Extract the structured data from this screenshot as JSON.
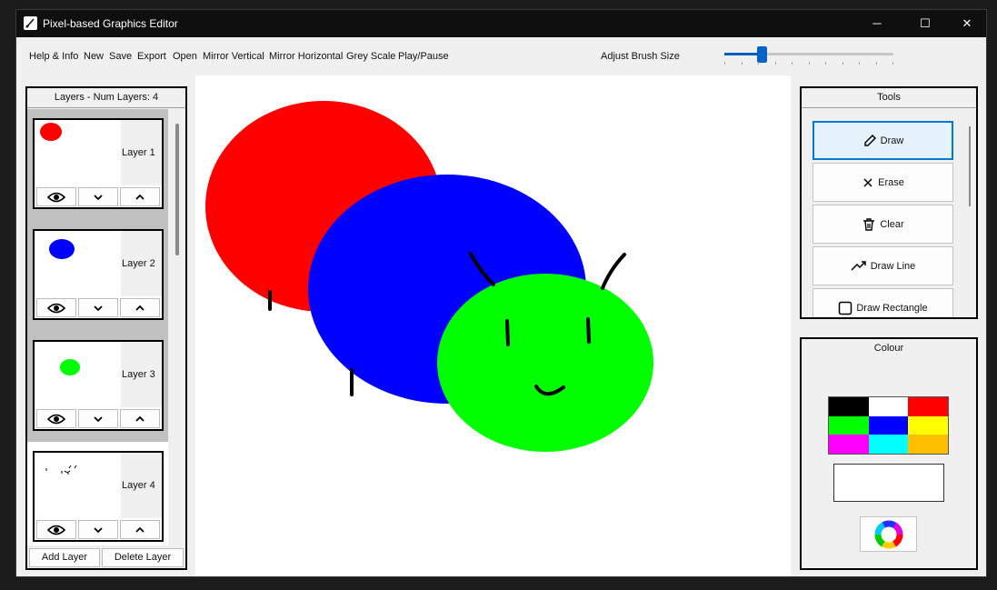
{
  "window": {
    "title": "Pixel-based Graphics Editor",
    "minimize_glyph": "─",
    "maximize_glyph": "☐",
    "close_glyph": "✕"
  },
  "menu": {
    "items": [
      "Help & Info",
      "New",
      "Save",
      "Export",
      "Open",
      "Mirror Vertical",
      "Mirror Horizontal",
      "Grey Scale",
      "Play/Pause"
    ],
    "brush_label": "Adjust Brush Size",
    "brush_size_fraction": 0.22
  },
  "layers": {
    "header": "Layers -  Num Layers: 4",
    "items": [
      {
        "label": "Layer 1",
        "selected": true
      },
      {
        "label": "Layer 2",
        "selected": true
      },
      {
        "label": "Layer 3",
        "selected": true
      },
      {
        "label": "Layer 4",
        "selected": false
      }
    ],
    "add_label": "Add Layer",
    "delete_label": "Delete Layer"
  },
  "tools": {
    "header": "Tools",
    "items": [
      {
        "label": "Draw",
        "icon": "pencil-icon",
        "active": true
      },
      {
        "label": "Erase",
        "icon": "x-icon",
        "active": false
      },
      {
        "label": "Clear",
        "icon": "trash-icon",
        "active": false
      },
      {
        "label": "Draw Line",
        "icon": "trend-line-icon",
        "active": false
      },
      {
        "label": "Draw Rectangle",
        "icon": "square-icon",
        "active": false
      }
    ]
  },
  "colour": {
    "header": "Colour",
    "palette": [
      "#000000",
      "#ffffff",
      "#ff0000",
      "#00ff00",
      "#0000ff",
      "#ffff00",
      "#ff00ff",
      "#00ffff",
      "#ffbf00"
    ],
    "current": "#ffffff"
  },
  "drawing": {
    "colors": {
      "red": "#ff0000",
      "blue": "#0000ff",
      "green": "#00ff00",
      "ink": "#000000"
    }
  }
}
